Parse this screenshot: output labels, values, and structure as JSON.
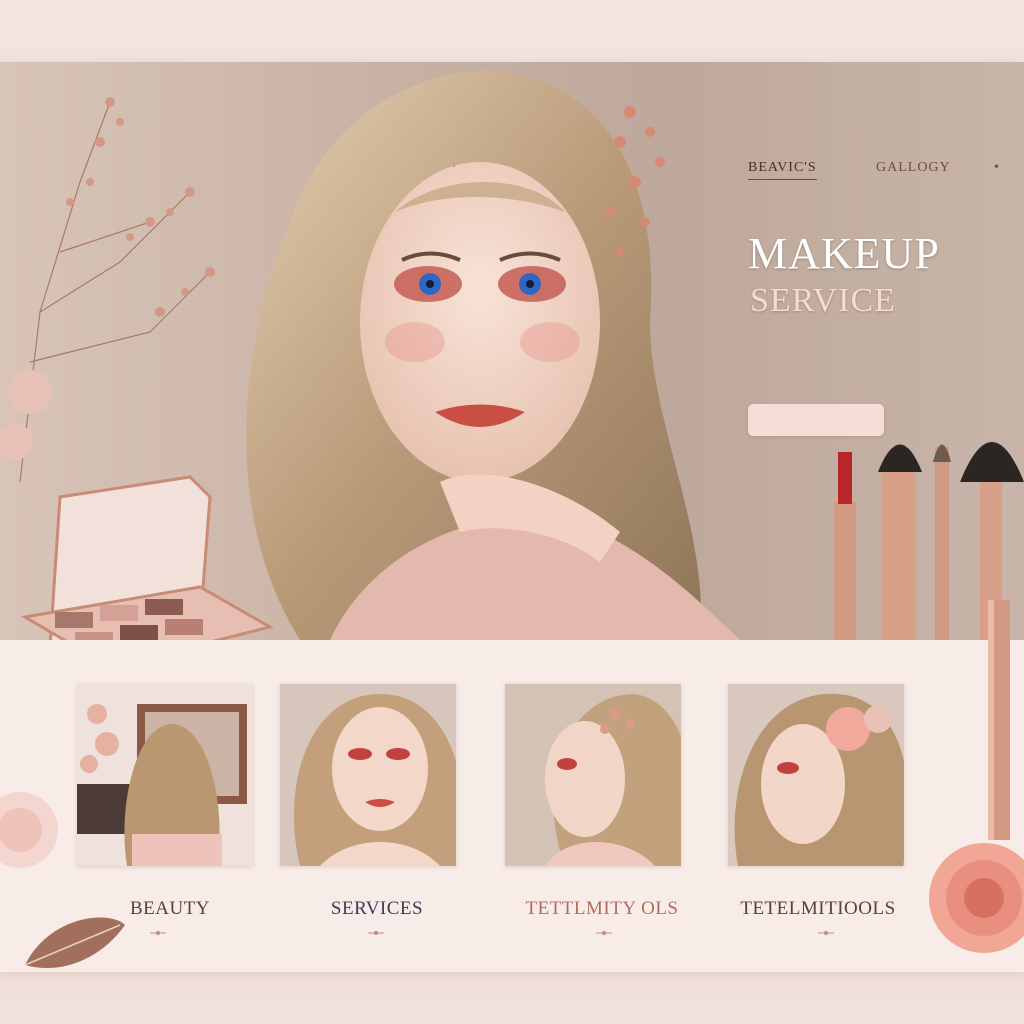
{
  "nav": {
    "items": [
      {
        "label": "BEAVIC'S"
      },
      {
        "label": "GALLOGY"
      }
    ]
  },
  "hero": {
    "title": "MAKEUP",
    "subtitle": "SERVICE",
    "description": "",
    "cta_label": ""
  },
  "gallery": {
    "cards": [
      {
        "label": "BEAUTY"
      },
      {
        "label": "SERVICES"
      },
      {
        "label": "TETTLMITY OLS"
      },
      {
        "label": "TETELMITIOOLS"
      }
    ]
  },
  "colors": {
    "accent": "#b66d62",
    "rose_gold": "#c98b76",
    "background": "#f6ebe7"
  },
  "icons": [
    "palette-icon",
    "makeup-brush-icon",
    "lipstick-icon",
    "flower-icon",
    "leaf-icon"
  ]
}
